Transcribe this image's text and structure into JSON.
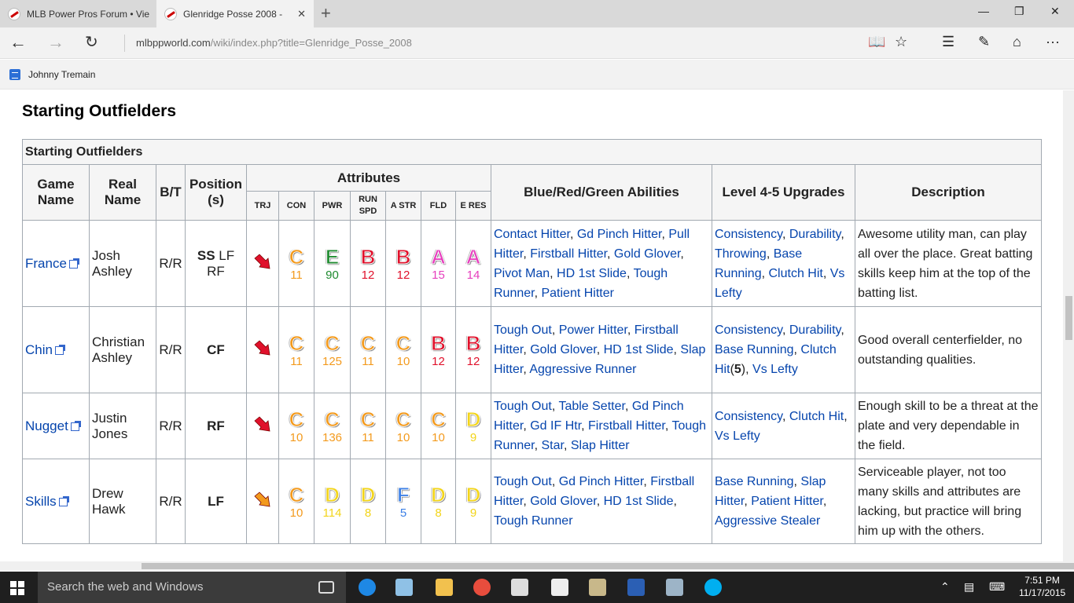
{
  "browser": {
    "tabs": [
      {
        "title": "MLB Power Pros Forum • Vie"
      },
      {
        "title": "Glenridge Posse 2008 -"
      }
    ],
    "address_domain": "mlbppworld.com",
    "address_path": "/wiki/index.php?title=Glenridge_Posse_2008",
    "favorites": [
      {
        "label": "Johnny Tremain"
      }
    ]
  },
  "page": {
    "heading": "Starting Outfielders",
    "table_caption": "Starting Outfielders",
    "headers": {
      "game_name": "Game Name",
      "real_name": "Real Name",
      "bt": "B/T",
      "position": "Position (s)",
      "attributes": "Attributes",
      "abilities": "Blue/Red/Green Abilities",
      "upgrades": "Level 4-5 Upgrades",
      "description": "Description",
      "sub": [
        "TRJ",
        "CON",
        "PWR",
        "RUN SPD",
        "A STR",
        "FLD",
        "E RES"
      ]
    },
    "rows": [
      {
        "game_name": "France",
        "real_name": "Josh Ashley",
        "bt": "R/R",
        "pos_main": "SS",
        "pos_other": " LF RF",
        "traj_color": "#e0112b",
        "attrs": [
          {
            "grade": "C",
            "value": "11",
            "color": "#f39a1d"
          },
          {
            "grade": "E",
            "value": "90",
            "color": "#1d8a2e"
          },
          {
            "grade": "B",
            "value": "12",
            "color": "#e0112b"
          },
          {
            "grade": "B",
            "value": "12",
            "color": "#e0112b"
          },
          {
            "grade": "A",
            "value": "15",
            "color": "#e63fbd"
          },
          {
            "grade": "A",
            "value": "14",
            "color": "#e63fbd"
          }
        ],
        "abilities": [
          "Contact Hitter",
          "Gd Pinch Hitter",
          "Pull Hitter",
          "Firstball Hitter",
          "Gold Glover",
          "Pivot Man",
          "HD 1st Slide",
          "Tough Runner",
          "Patient Hitter"
        ],
        "upgrades": [
          "Consistency",
          "Durability",
          "Throwing",
          "Base Running",
          "Clutch Hit",
          "Vs Lefty"
        ],
        "description": "Awesome utility man, can play all over the place. Great batting skills keep him at the top of the batting list."
      },
      {
        "game_name": "Chin",
        "real_name": "Christian Ashley",
        "bt": "R/R",
        "pos_main": "CF",
        "pos_other": "",
        "traj_color": "#e0112b",
        "attrs": [
          {
            "grade": "C",
            "value": "11",
            "color": "#f39a1d"
          },
          {
            "grade": "C",
            "value": "125",
            "color": "#f39a1d"
          },
          {
            "grade": "C",
            "value": "11",
            "color": "#f39a1d"
          },
          {
            "grade": "C",
            "value": "10",
            "color": "#f39a1d"
          },
          {
            "grade": "B",
            "value": "12",
            "color": "#e0112b"
          },
          {
            "grade": "B",
            "value": "12",
            "color": "#e0112b"
          }
        ],
        "abilities": [
          "Tough Out",
          "Power Hitter",
          "Firstball Hitter",
          "Gold Glover",
          "HD 1st Slide",
          "Slap Hitter",
          "Aggressive Runner"
        ],
        "upgrades": [
          "Consistency",
          "Durability",
          "Base Running",
          "Clutch Hit",
          "Vs Lefty"
        ],
        "upgrade_note": "5",
        "description": "Good overall centerfielder, no outstanding qualities."
      },
      {
        "game_name": "Nugget",
        "real_name": "Justin Jones",
        "bt": "R/R",
        "pos_main": "RF",
        "pos_other": "",
        "traj_color": "#e0112b",
        "attrs": [
          {
            "grade": "C",
            "value": "10",
            "color": "#f39a1d"
          },
          {
            "grade": "C",
            "value": "136",
            "color": "#f39a1d"
          },
          {
            "grade": "C",
            "value": "11",
            "color": "#f39a1d"
          },
          {
            "grade": "C",
            "value": "10",
            "color": "#f39a1d"
          },
          {
            "grade": "C",
            "value": "10",
            "color": "#f39a1d"
          },
          {
            "grade": "D",
            "value": "9",
            "color": "#f2d41a"
          }
        ],
        "abilities": [
          "Tough Out",
          "Table Setter",
          "Gd Pinch Hitter",
          "Gd IF Htr",
          "Firstball Hitter",
          "Tough Runner",
          "Star",
          "Slap Hitter"
        ],
        "upgrades": [
          "Consistency",
          "Clutch Hit",
          "Vs Lefty"
        ],
        "description": "Enough skill to be a threat at the plate and very dependable in the field."
      },
      {
        "game_name": "Skills",
        "real_name": "Drew Hawk",
        "bt": "R/R",
        "pos_main": "LF",
        "pos_other": "",
        "traj_color": "#f39a1d",
        "attrs": [
          {
            "grade": "C",
            "value": "10",
            "color": "#f39a1d"
          },
          {
            "grade": "D",
            "value": "114",
            "color": "#f2d41a"
          },
          {
            "grade": "D",
            "value": "8",
            "color": "#f2d41a"
          },
          {
            "grade": "F",
            "value": "5",
            "color": "#3b7fe6"
          },
          {
            "grade": "D",
            "value": "8",
            "color": "#f2d41a"
          },
          {
            "grade": "D",
            "value": "9",
            "color": "#f2d41a"
          }
        ],
        "abilities": [
          "Tough Out",
          "Gd Pinch Hitter",
          "Firstball Hitter",
          "Gold Glover",
          "HD 1st Slide",
          "Tough Runner"
        ],
        "upgrades": [
          "Base Running",
          "Slap Hitter",
          "Patient Hitter",
          "Aggressive Stealer"
        ],
        "description": "Serviceable player, not too many skills and attributes are lacking, but practice will bring him up with the others."
      }
    ]
  },
  "taskbar": {
    "search_placeholder": "Search the web and Windows",
    "time": "7:51 PM",
    "date": "11/17/2015"
  }
}
